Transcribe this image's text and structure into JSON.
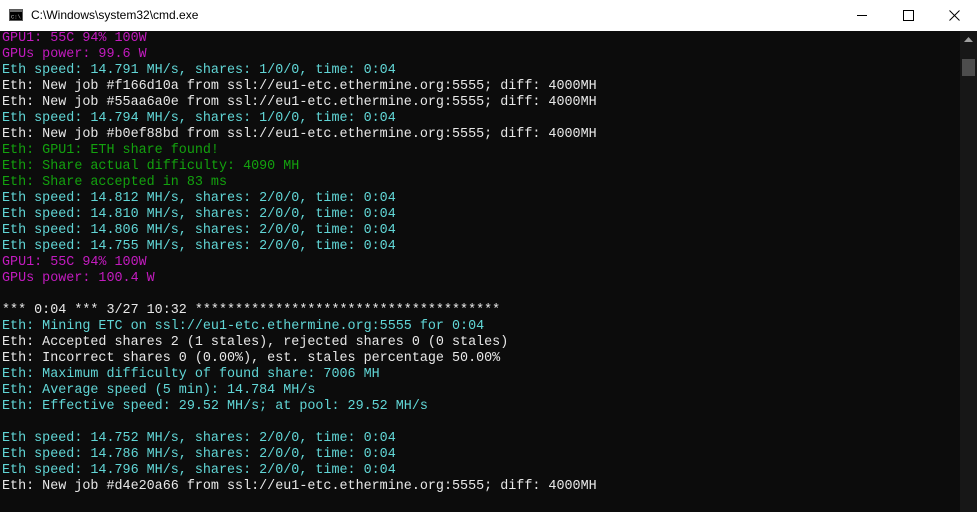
{
  "window": {
    "title": "C:\\Windows\\system32\\cmd.exe",
    "icon": "cmd-icon"
  },
  "controls": {
    "minimize_icon": "minimize-icon",
    "maximize_icon": "maximize-icon",
    "close_icon": "close-icon"
  },
  "colors": {
    "titlebar_bg": "#ffffff",
    "console_bg": "#0c0c0c",
    "magenta": "#c31bbf",
    "cyan": "#61d6d6",
    "white": "#e8e8e8",
    "green": "#13a10e",
    "scroll_track": "#171717",
    "scroll_thumb": "#4d4d4d"
  },
  "console": {
    "lines": [
      {
        "text": "GPU1: 55C 94% 100W",
        "color": "magenta"
      },
      {
        "text": "GPUs power: 99.6 W",
        "color": "magenta"
      },
      {
        "text": "Eth speed: 14.791 MH/s, shares: 1/0/0, time: 0:04",
        "color": "cyan"
      },
      {
        "text": "Eth: New job #f166d10a from ssl://eu1-etc.ethermine.org:5555; diff: 4000MH",
        "color": "white"
      },
      {
        "text": "Eth: New job #55aa6a0e from ssl://eu1-etc.ethermine.org:5555; diff: 4000MH",
        "color": "white"
      },
      {
        "text": "Eth speed: 14.794 MH/s, shares: 1/0/0, time: 0:04",
        "color": "cyan"
      },
      {
        "text": "Eth: New job #b0ef88bd from ssl://eu1-etc.ethermine.org:5555; diff: 4000MH",
        "color": "white"
      },
      {
        "text": "Eth: GPU1: ETH share found!",
        "color": "green"
      },
      {
        "text": "Eth: Share actual difficulty: 4090 MH",
        "color": "green"
      },
      {
        "text": "Eth: Share accepted in 83 ms",
        "color": "green"
      },
      {
        "text": "Eth speed: 14.812 MH/s, shares: 2/0/0, time: 0:04",
        "color": "cyan"
      },
      {
        "text": "Eth speed: 14.810 MH/s, shares: 2/0/0, time: 0:04",
        "color": "cyan"
      },
      {
        "text": "Eth speed: 14.806 MH/s, shares: 2/0/0, time: 0:04",
        "color": "cyan"
      },
      {
        "text": "Eth speed: 14.755 MH/s, shares: 2/0/0, time: 0:04",
        "color": "cyan"
      },
      {
        "text": "GPU1: 55C 94% 100W",
        "color": "magenta"
      },
      {
        "text": "GPUs power: 100.4 W",
        "color": "magenta"
      },
      {
        "text": "",
        "color": "white"
      },
      {
        "text": "*** 0:04 *** 3/27 10:32 **************************************",
        "color": "white"
      },
      {
        "text": "Eth: Mining ETC on ssl://eu1-etc.ethermine.org:5555 for 0:04",
        "color": "cyan"
      },
      {
        "text": "Eth: Accepted shares 2 (1 stales), rejected shares 0 (0 stales)",
        "color": "white"
      },
      {
        "text": "Eth: Incorrect shares 0 (0.00%), est. stales percentage 50.00%",
        "color": "white"
      },
      {
        "text": "Eth: Maximum difficulty of found share: 7006 MH",
        "color": "cyan"
      },
      {
        "text": "Eth: Average speed (5 min): 14.784 MH/s",
        "color": "cyan"
      },
      {
        "text": "Eth: Effective speed: 29.52 MH/s; at pool: 29.52 MH/s",
        "color": "cyan"
      },
      {
        "text": "",
        "color": "white"
      },
      {
        "text": "Eth speed: 14.752 MH/s, shares: 2/0/0, time: 0:04",
        "color": "cyan"
      },
      {
        "text": "Eth speed: 14.786 MH/s, shares: 2/0/0, time: 0:04",
        "color": "cyan"
      },
      {
        "text": "Eth speed: 14.796 MH/s, shares: 2/0/0, time: 0:04",
        "color": "cyan"
      },
      {
        "text": "Eth: New job #d4e20a66 from ssl://eu1-etc.ethermine.org:5555; diff: 4000MH",
        "color": "white"
      }
    ]
  }
}
